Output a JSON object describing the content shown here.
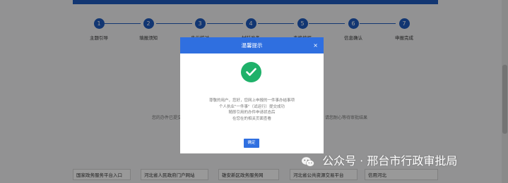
{
  "steps": [
    {
      "num": "1",
      "label": "主题引导"
    },
    {
      "num": "2",
      "label": "填报须知"
    },
    {
      "num": "3",
      "label": "身份核对"
    },
    {
      "num": "4",
      "label": "材料准备"
    },
    {
      "num": "5",
      "label": "表格填报"
    },
    {
      "num": "6",
      "label": "信息确认"
    },
    {
      "num": "7",
      "label": "申报完成"
    }
  ],
  "background": {
    "left_text": "您的办件已提交",
    "right_text": "请您耐心等待审批结果"
  },
  "footer_links": [
    "国家政务服务平台入口",
    "河北省人民政府门户网站",
    "雄安新区政务服务网",
    "河北省公共资源交易平台",
    "信用河北"
  ],
  "modal": {
    "title": "温馨提示",
    "close_symbol": "×",
    "message_lines": [
      "尊敬的用户，您好，您网上申报的一件事办结事项",
      "个人执业\"一件事\"（试运行）提交成功",
      "随即引用的办件申请状态后",
      "在您在的相关页面查看"
    ],
    "confirm_label": "确定"
  },
  "watermark": {
    "text": "公众号 · 邢台市行政审批局"
  },
  "colors": {
    "primary": "#2f6fe0",
    "step": "#1e5bbf",
    "success": "#1fb16a"
  }
}
